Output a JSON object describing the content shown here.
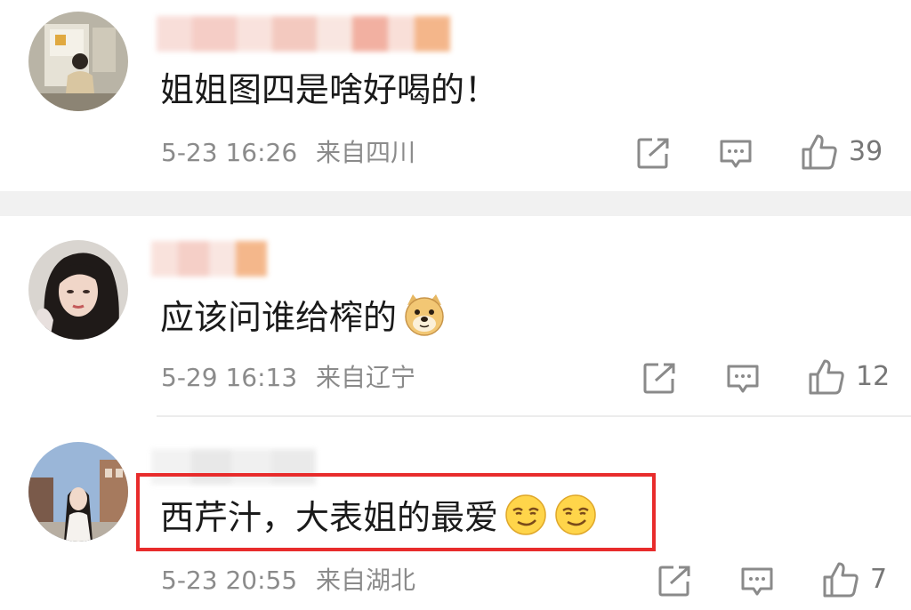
{
  "comments": [
    {
      "text": "姐姐图四是啥好喝的！",
      "time": "5-23 16:26",
      "location": "来自四川",
      "likes": "39",
      "avatar_icon": "person-photo-avatar",
      "emojis": []
    },
    {
      "text": "应该问谁给榨的",
      "time": "5-29 16:13",
      "location": "来自辽宁",
      "likes": "12",
      "avatar_icon": "person-photo-avatar",
      "emojis": [
        "doge-emoji"
      ]
    },
    {
      "text": "西芹汁，大表姐的最爱",
      "time": "5-23 20:55",
      "location": "来自湖北",
      "likes": "7",
      "avatar_icon": "person-photo-avatar",
      "emojis": [
        "smirk-emoji",
        "smirk-emoji"
      ]
    }
  ],
  "colors": {
    "highlight_border": "#e82c2c",
    "meta_text": "#8b8b8b",
    "divider": "#f1f1f1"
  },
  "icons": {
    "share": "share-icon",
    "reply": "comment-icon",
    "like": "thumbs-up-icon"
  }
}
